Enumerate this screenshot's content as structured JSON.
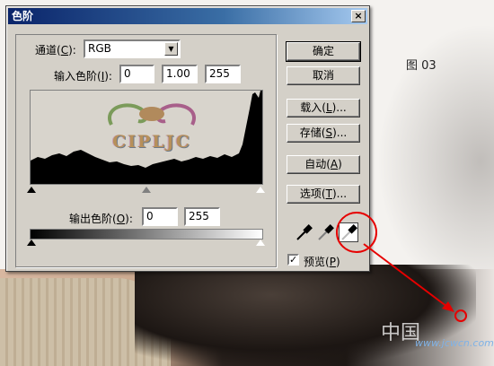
{
  "figure_label": "图 03",
  "watermark": {
    "cn": "中国",
    "url": "www.jcwcn.com"
  },
  "logo_text": "CIPLJC",
  "dialog": {
    "title": "色阶",
    "close_glyph": "×",
    "channel": {
      "label": "通道(",
      "key": "C",
      "tail": "):",
      "value": "RGB"
    },
    "input_levels": {
      "label": "输入色阶(",
      "key": "I",
      "tail": "):",
      "values": [
        "0",
        "1.00",
        "255"
      ]
    },
    "output_levels": {
      "label": "输出色阶(",
      "key": "O",
      "tail": "):",
      "values": [
        "0",
        "255"
      ]
    },
    "buttons": {
      "ok": "确定",
      "cancel": "取消",
      "load": {
        "label": "载入(",
        "key": "L",
        "tail": ")..."
      },
      "save": {
        "label": "存储(",
        "key": "S",
        "tail": ")..."
      },
      "auto": {
        "label": "自动(",
        "key": "A",
        "tail": ")"
      },
      "options": {
        "label": "选项(",
        "key": "T",
        "tail": ")..."
      }
    },
    "preview": {
      "label": "预览(",
      "key": "P",
      "tail": ")",
      "checked_glyph": "✓"
    },
    "eyedroppers": [
      "black-point-eyedropper-icon",
      "gray-point-eyedropper-icon",
      "white-point-eyedropper-icon"
    ]
  },
  "colors": {
    "annotation_red": "#e60000",
    "titlebar": "#0a246a"
  }
}
